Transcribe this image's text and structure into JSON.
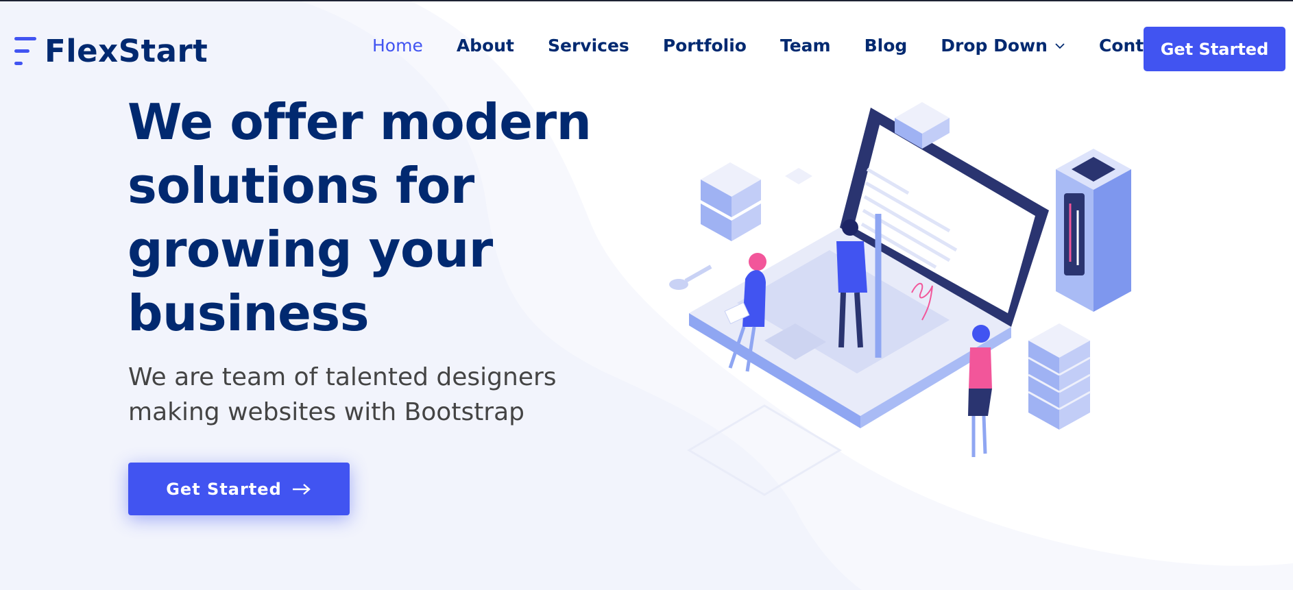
{
  "brand": {
    "name": "FlexStart"
  },
  "nav": {
    "items": [
      {
        "label": "Home",
        "active": true
      },
      {
        "label": "About"
      },
      {
        "label": "Services"
      },
      {
        "label": "Portfolio"
      },
      {
        "label": "Team"
      },
      {
        "label": "Blog"
      },
      {
        "label": "Drop Down",
        "icon": "chevron-down-icon"
      },
      {
        "label": "Contact"
      }
    ],
    "cta_label": "Get Started"
  },
  "hero": {
    "title": "We offer modern solutions for growing your business",
    "subtitle": "We are team of talented designers making websites with Bootstrap",
    "cta_label": "Get Started",
    "cta_icon": "arrow-right-icon"
  },
  "colors": {
    "primary": "#4154f1",
    "heading": "#012970",
    "text": "#444444",
    "background_wave": "#f2f4fc"
  }
}
